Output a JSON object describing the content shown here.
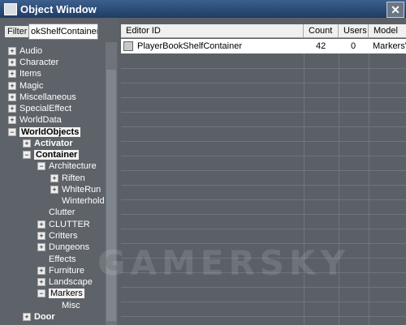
{
  "window": {
    "title": "Object Window"
  },
  "filter": {
    "label": "Filter",
    "value": "okShelfContainer"
  },
  "tree": [
    {
      "label": "Audio",
      "toggle": "+"
    },
    {
      "label": "Character",
      "toggle": "+"
    },
    {
      "label": "Items",
      "toggle": "+"
    },
    {
      "label": "Magic",
      "toggle": "+"
    },
    {
      "label": "Miscellaneous",
      "toggle": "+"
    },
    {
      "label": "SpecialEffect",
      "toggle": "+"
    },
    {
      "label": "WorldData",
      "toggle": "+"
    },
    {
      "label": "WorldObjects",
      "toggle": "−"
    },
    {
      "label": "Activator",
      "toggle": "+"
    },
    {
      "label": "Container",
      "toggle": "−"
    },
    {
      "label": "Architecture",
      "toggle": "−"
    },
    {
      "label": "Riften",
      "toggle": "+"
    },
    {
      "label": "WhiteRun",
      "toggle": "+"
    },
    {
      "label": "Winterhold",
      "toggle": ""
    },
    {
      "label": "Clutter",
      "toggle": ""
    },
    {
      "label": "CLUTTER",
      "toggle": "+"
    },
    {
      "label": "Critters",
      "toggle": "+"
    },
    {
      "label": "Dungeons",
      "toggle": "+"
    },
    {
      "label": "Effects",
      "toggle": ""
    },
    {
      "label": "Furniture",
      "toggle": "+"
    },
    {
      "label": "Landscape",
      "toggle": "+"
    },
    {
      "label": "Markers",
      "toggle": "−"
    },
    {
      "label": "Misc",
      "toggle": ""
    },
    {
      "label": "Door",
      "toggle": "+"
    }
  ],
  "table": {
    "columns": [
      "Editor ID",
      "Count",
      "Users",
      "Model"
    ],
    "rows": [
      {
        "editor_id": "PlayerBookShelfContainer",
        "count": "42",
        "users": "0",
        "model": "MarkersV"
      }
    ]
  },
  "watermark": "GAMERSKY"
}
